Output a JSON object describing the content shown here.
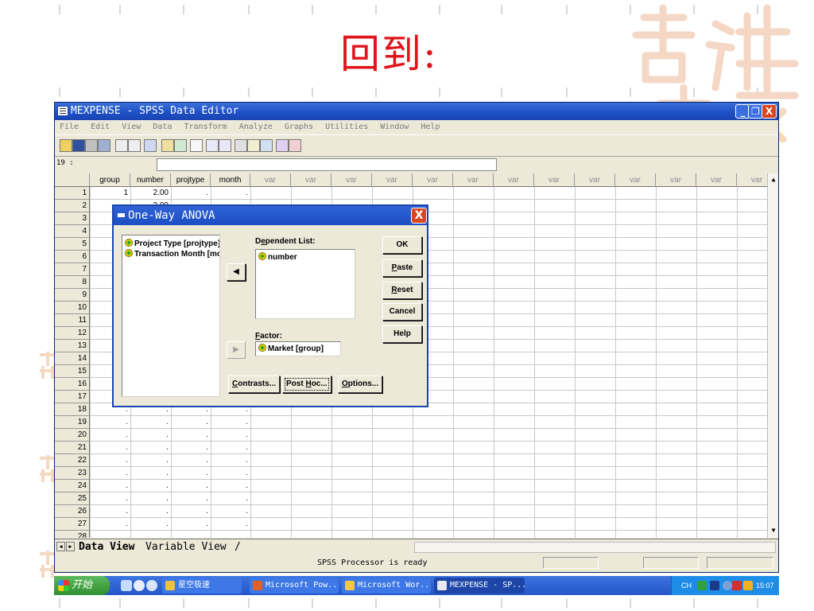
{
  "slide": {
    "title": "回到",
    "colon": ":"
  },
  "window": {
    "title": "MEXPENSE - SPSS Data Editor",
    "controls": {
      "min": "_",
      "max": "❐",
      "close": "X"
    },
    "menu": [
      "File",
      "Edit",
      "View",
      "Data",
      "Transform",
      "Analyze",
      "Graphs",
      "Utilities",
      "Window",
      "Help"
    ],
    "cell_ref": "19 :",
    "columns": [
      "group",
      "number",
      "projtype",
      "month",
      "var",
      "var",
      "var",
      "var",
      "var",
      "var",
      "var",
      "var",
      "var",
      "var",
      "var",
      "var",
      "var"
    ],
    "rows": [
      "1",
      "2",
      "3",
      "4",
      "5",
      "6",
      "7",
      "8",
      "9",
      "10",
      "11",
      "12",
      "13",
      "14",
      "15",
      "16",
      "17",
      "18",
      "19",
      "20",
      "21",
      "22",
      "23",
      "24",
      "25",
      "26",
      "27",
      "28"
    ],
    "row1": {
      "group": "1",
      "number": "2.00",
      "projtype": ".",
      "month": "."
    },
    "row2_number": "2.00",
    "dot": ".",
    "tabs": {
      "data_view": "Data View",
      "variable_view": "Variable View",
      "sep": "/"
    },
    "status": "SPSS Processor  is ready"
  },
  "dialog": {
    "title": "One-Way ANOVA",
    "close": "X",
    "source_vars": [
      "Project Type [projtype]",
      "Transaction Month [mo"
    ],
    "dependent_label_pre": "D",
    "dependent_label_ul": "e",
    "dependent_label_post": "pendent List:",
    "dependent_vars": [
      "number"
    ],
    "factor_label_ul": "F",
    "factor_label_post": "actor:",
    "factor_value": "Market [group]",
    "move_left": "◀",
    "move_right": "▶",
    "buttons": {
      "ok": "OK",
      "paste_ul": "P",
      "paste": "aste",
      "reset_ul": "R",
      "reset": "eset",
      "cancel": "Cancel",
      "help": "Help",
      "contrasts_ul": "C",
      "contrasts": "ontrasts...",
      "posthoc_pre": "Post ",
      "posthoc_ul": "H",
      "posthoc": "oc...",
      "options_ul": "O",
      "options": "ptions..."
    }
  },
  "taskbar": {
    "start": "开始",
    "items": [
      "星空极速",
      "Microsoft Pow...",
      "Microsoft Wor...",
      "MEXPENSE - SP..."
    ],
    "tray_lang": "CH",
    "clock": "15:07"
  },
  "colors": {
    "title_red": "#e0151b",
    "xp_blue": "#1d4fc4",
    "close_red": "#d9461f"
  }
}
